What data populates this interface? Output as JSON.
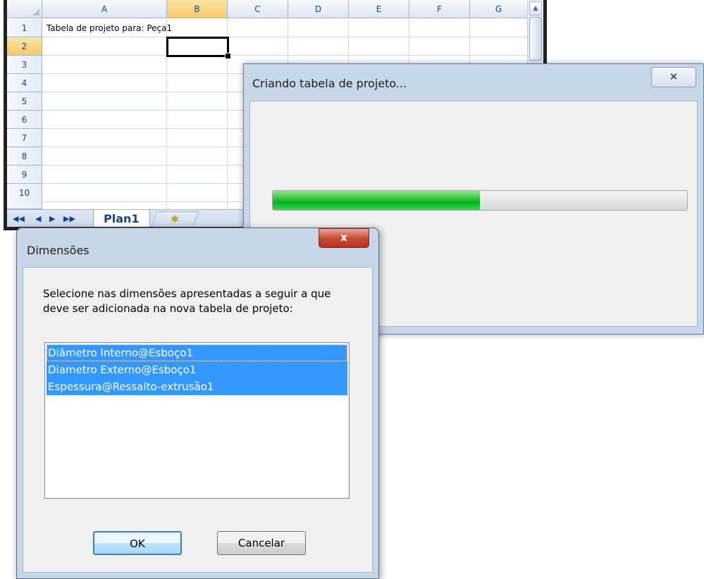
{
  "spreadsheet": {
    "columns": [
      "A",
      "B",
      "C",
      "D",
      "E",
      "F",
      "G"
    ],
    "rows": [
      "1",
      "2",
      "3",
      "4",
      "5",
      "6",
      "7",
      "8",
      "9",
      "10"
    ],
    "cell_a1": "Tabela de projeto para: Peça1",
    "sheet_tab": "Plan1",
    "nav": {
      "first": "◀◀",
      "prev": "◀",
      "next": "▶",
      "last": "▶▶"
    }
  },
  "progress_dialog": {
    "title": "Criando tabela de projeto...",
    "close_label": "✕",
    "progress": 0.5
  },
  "dimensions_dialog": {
    "title": "Dimensões",
    "close_label": "x",
    "instructions": "Selecione nas dimensões apresentadas a seguir a que deve ser adicionada na nova tabela de projeto:",
    "items": [
      "Diâmetro Interno@Esboço1",
      "Diametro Externo@Esboço1",
      "Espessura@Ressalto-extrusão1"
    ],
    "ok_label": "OK",
    "cancel_label": "Cancelar"
  }
}
